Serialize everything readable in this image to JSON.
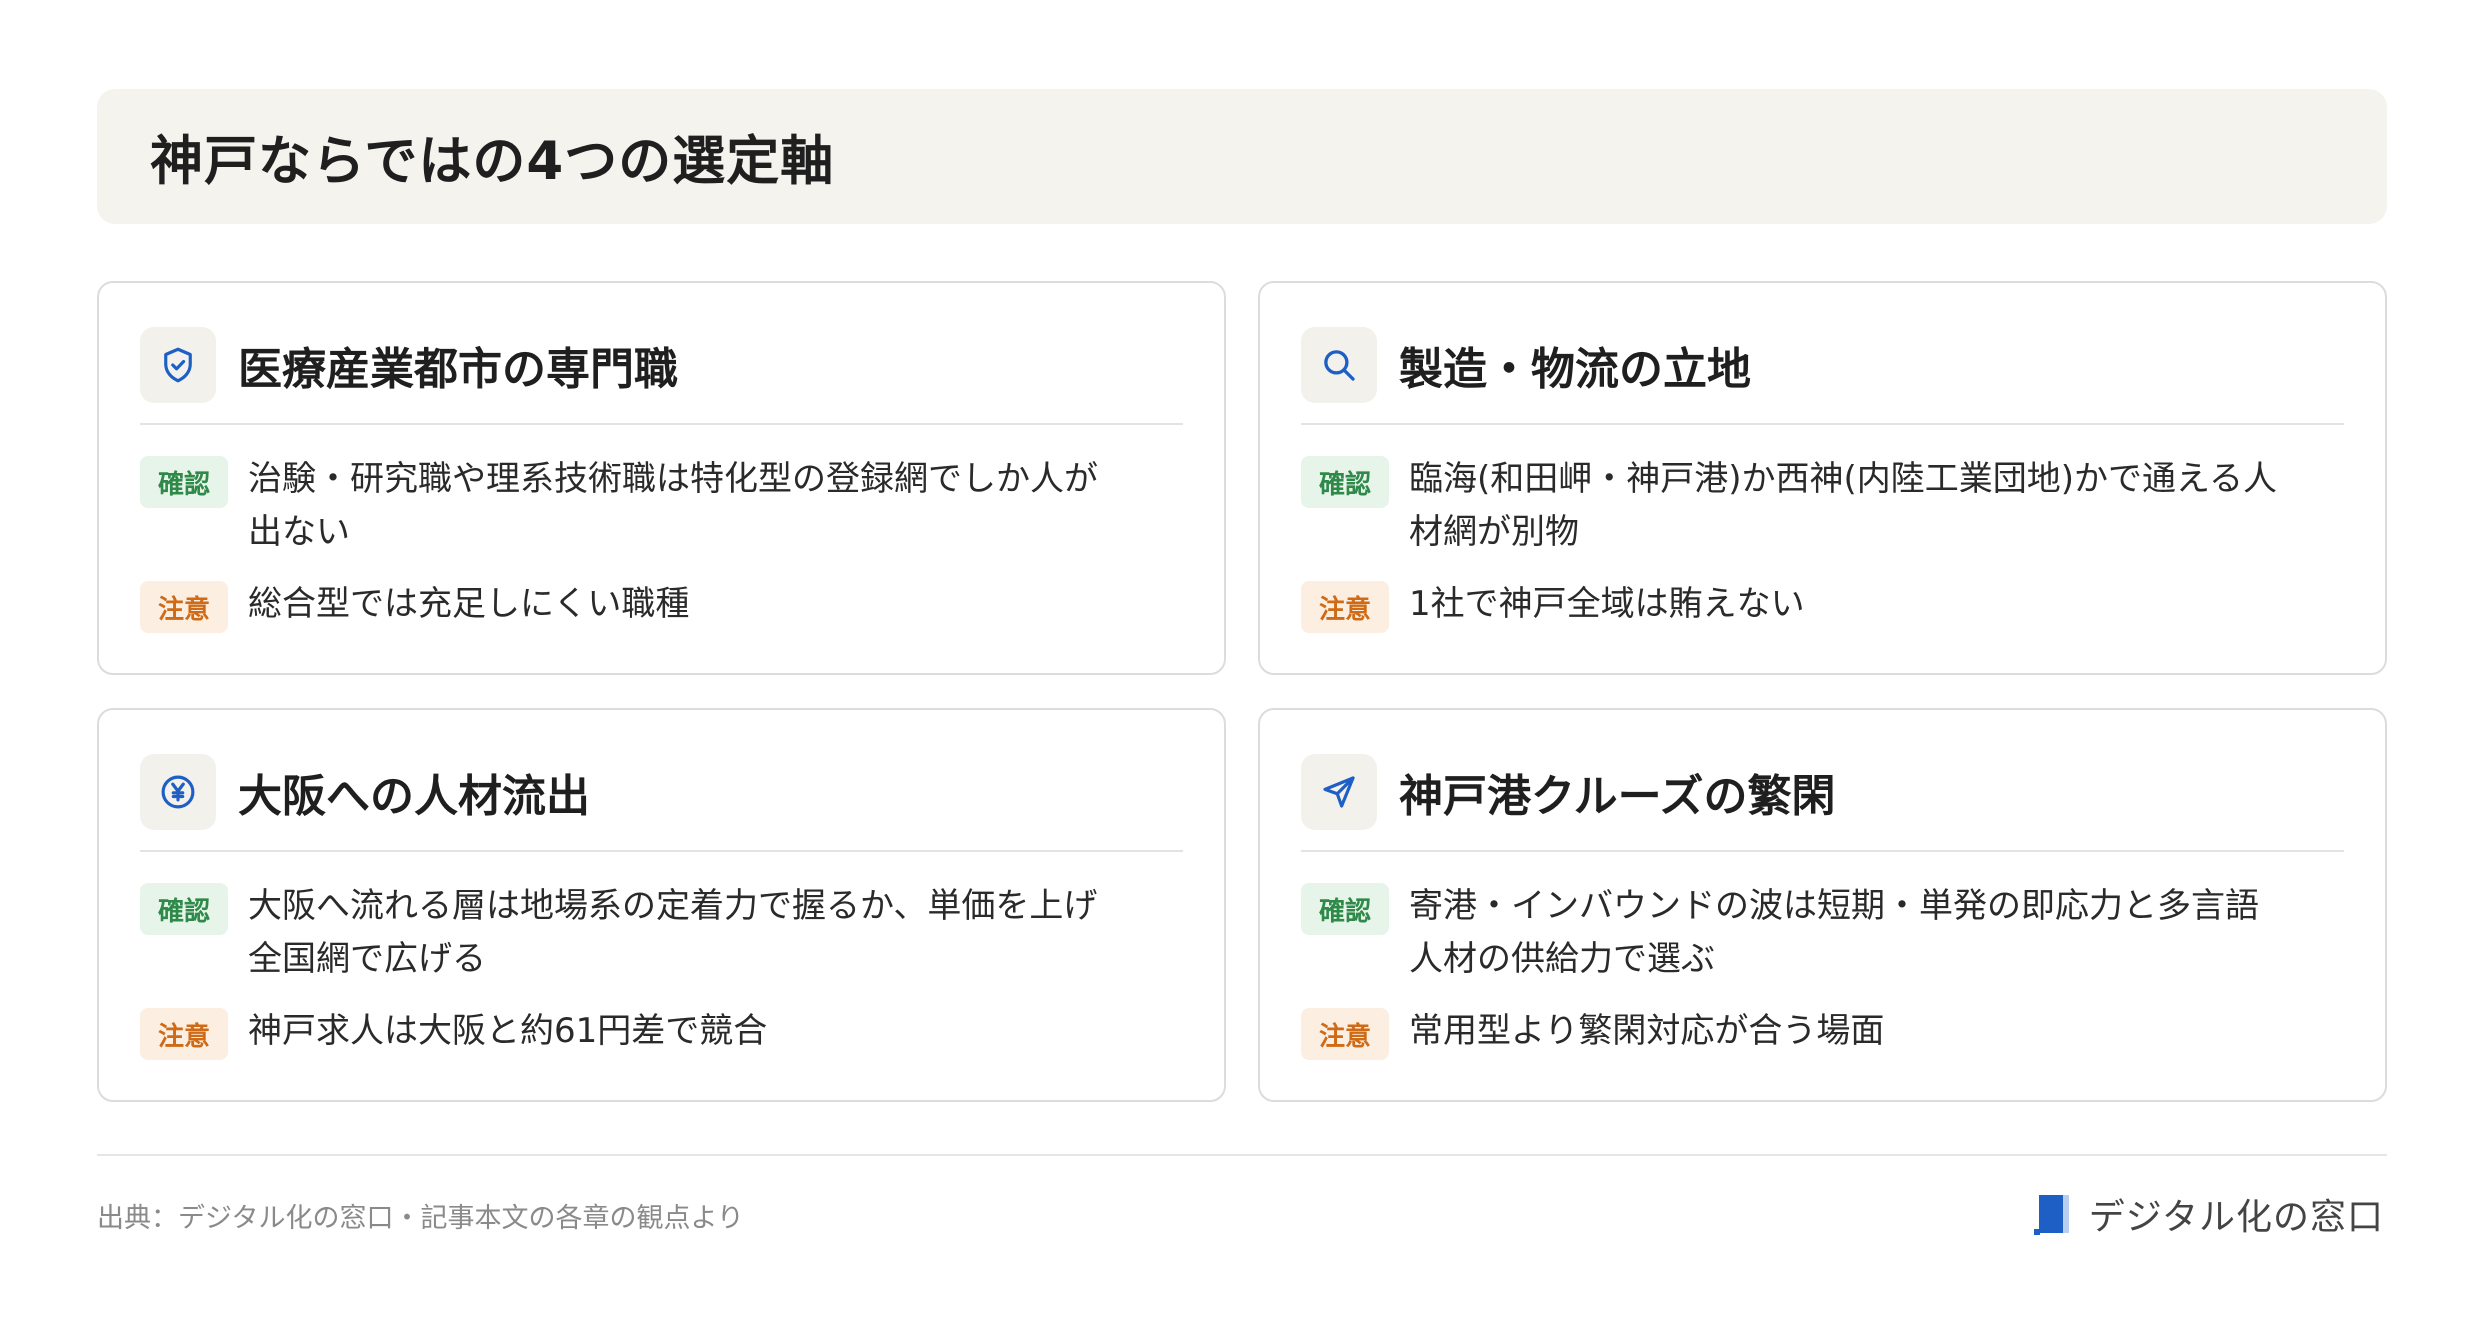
{
  "header": {
    "title": "神戸ならではの4つの選定軸"
  },
  "cards": [
    {
      "icon": "shield-check-icon",
      "title": "医療産業都市の専門職",
      "confirm_label": "確認",
      "confirm_text": "治験・研究職や理系技術職は特化型の登録網でしか人が出ない",
      "caution_label": "注意",
      "caution_text": "総合型では充足しにくい職種"
    },
    {
      "icon": "search-icon",
      "title": "製造・物流の立地",
      "confirm_label": "確認",
      "confirm_text": "臨海(和田岬・神戸港)か西神(内陸工業団地)かで通える人材網が別物",
      "caution_label": "注意",
      "caution_text": "1社で神戸全域は賄えない"
    },
    {
      "icon": "yen-circle-icon",
      "title": "大阪への人材流出",
      "confirm_label": "確認",
      "confirm_text": "大阪へ流れる層は地場系の定着力で握るか、単価を上げ全国網で広げる",
      "caution_label": "注意",
      "caution_text": "神戸求人は大阪と約61円差で競合"
    },
    {
      "icon": "send-icon",
      "title": "神戸港クルーズの繁閑",
      "confirm_label": "確認",
      "confirm_text": "寄港・インバウンドの波は短期・単発の即応力と多言語人材の供給力で選ぶ",
      "caution_label": "注意",
      "caution_text": "常用型より繁閑対応が合う場面"
    }
  ],
  "footer": {
    "source": "出典：デジタル化の窓口・記事本文の各章の観点より",
    "brand": "デジタル化の窓口"
  },
  "colors": {
    "accent_blue": "#1d5fc4",
    "confirm_green": "#2f8a4a",
    "caution_orange": "#cf6a16"
  }
}
